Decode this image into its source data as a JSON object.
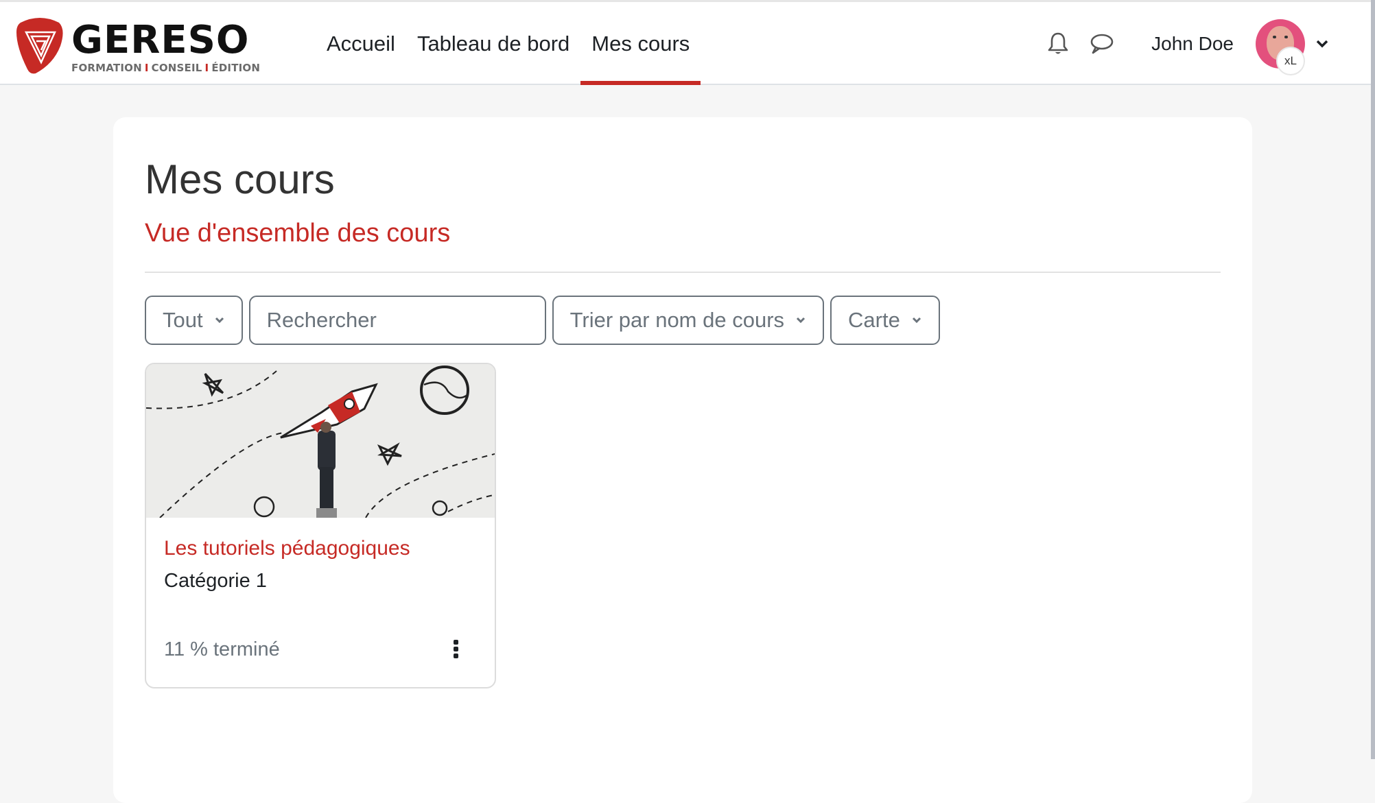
{
  "header": {
    "logo": {
      "name": "GERESO",
      "tagline_parts": [
        "FORMATION",
        "CONSEIL",
        "ÉDITION"
      ],
      "brand_color": "#c62a25"
    },
    "nav": [
      {
        "label": "Accueil",
        "active": false
      },
      {
        "label": "Tableau de bord",
        "active": false
      },
      {
        "label": "Mes cours",
        "active": true
      }
    ],
    "icons": [
      "bell-icon",
      "chat-bubble-icon"
    ],
    "user": {
      "name": "John Doe",
      "avatar_badge": "xL"
    }
  },
  "main": {
    "title": "Mes cours",
    "section_title": "Vue d'ensemble des cours",
    "controls": {
      "filter": {
        "value": "Tout"
      },
      "search": {
        "placeholder": "Rechercher",
        "value": ""
      },
      "sort": {
        "value": "Trier par nom de cours"
      },
      "view": {
        "value": "Carte"
      }
    },
    "courses": [
      {
        "title": "Les tutoriels pédagogiques",
        "category": "Catégorie 1",
        "progress_percent": 11,
        "progress_label": "11 % terminé",
        "image": "rocket-illustration"
      }
    ]
  }
}
